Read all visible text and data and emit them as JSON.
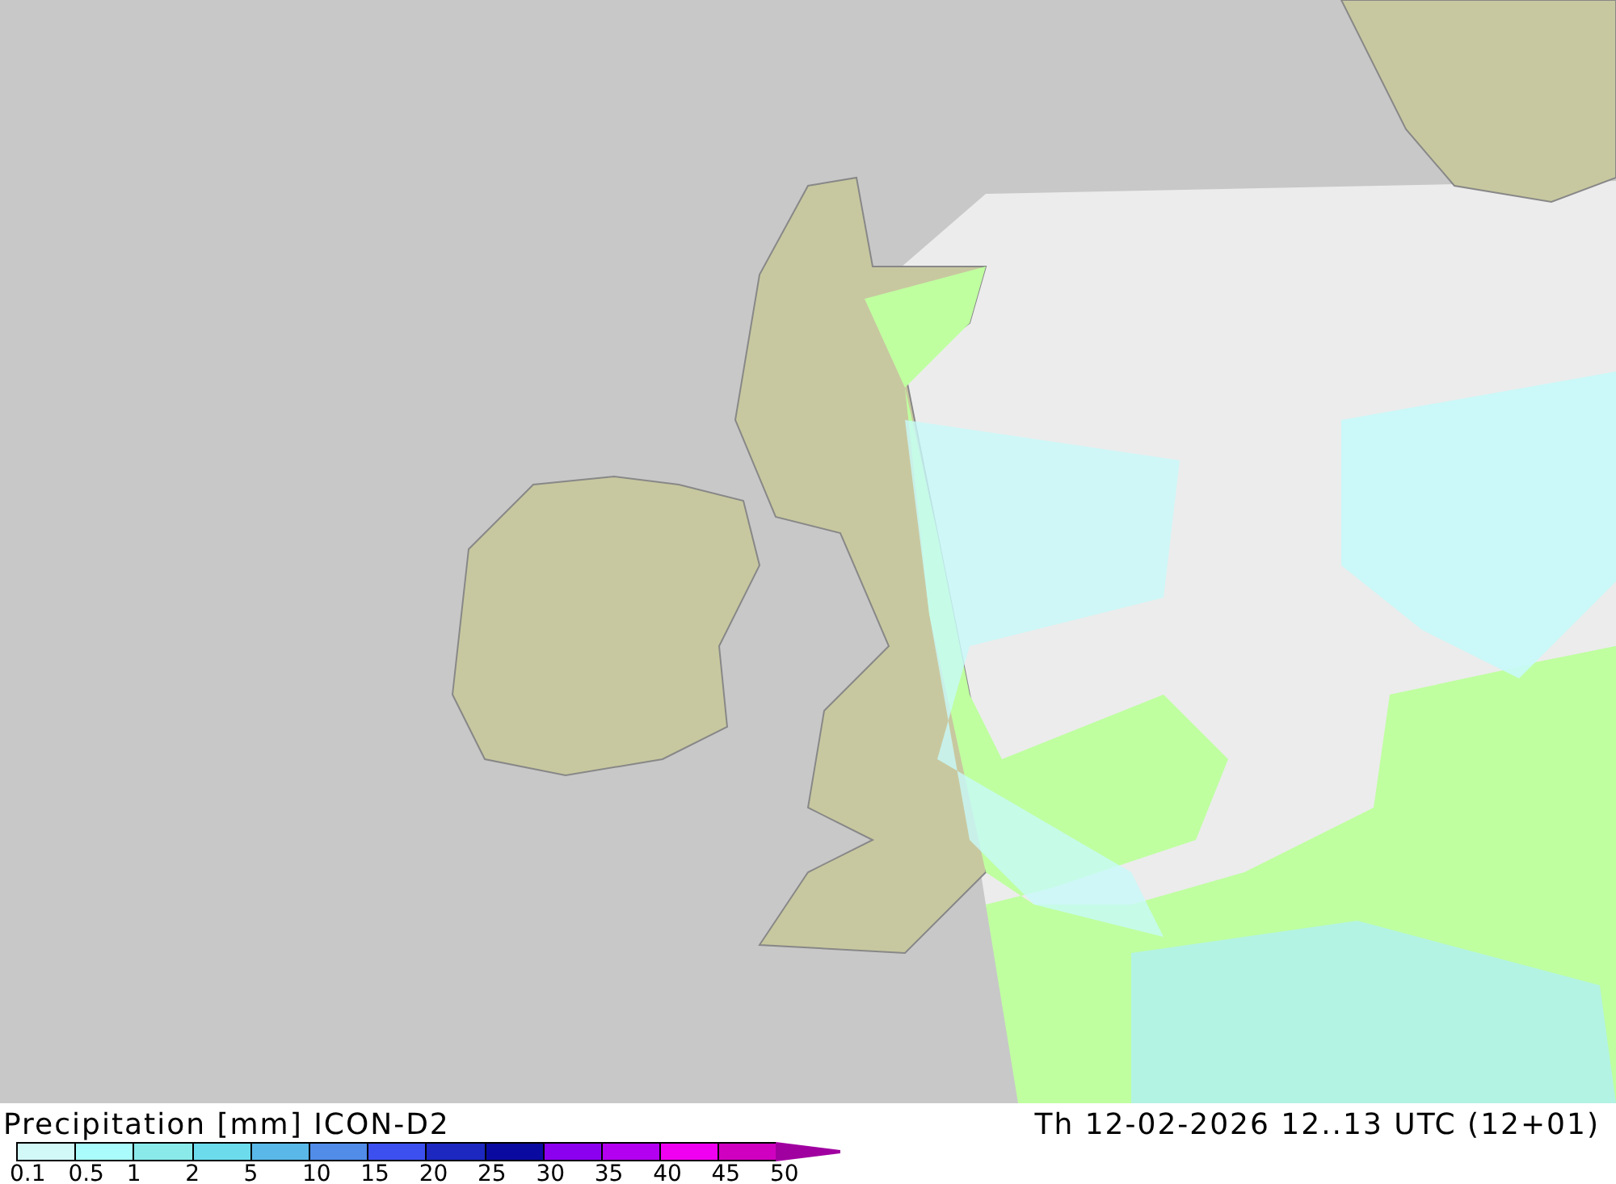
{
  "map": {
    "title": "Precipitation [mm] ICON-D2",
    "valid_time": "Th 12-02-2026 12..13 UTC (12+01)"
  },
  "legend": [
    {
      "kind": "swatch",
      "label": "0.1",
      "color": "#d2f8f8"
    },
    {
      "kind": "swatch",
      "label": "0.5",
      "color": "#aafcfc"
    },
    {
      "kind": "swatch",
      "label": "1",
      "color": "#8aeaea"
    },
    {
      "kind": "swatch",
      "label": "2",
      "color": "#6cdcec"
    },
    {
      "kind": "swatch",
      "label": "5",
      "color": "#5ab8e8"
    },
    {
      "kind": "swatch",
      "label": "10",
      "color": "#508ce8"
    },
    {
      "kind": "swatch",
      "label": "15",
      "color": "#3c50f0"
    },
    {
      "kind": "swatch",
      "label": "20",
      "color": "#1c28c0"
    },
    {
      "kind": "swatch",
      "label": "25",
      "color": "#0a0aa0"
    },
    {
      "kind": "swatch",
      "label": "30",
      "color": "#8c00f0"
    },
    {
      "kind": "swatch",
      "label": "35",
      "color": "#b400f0"
    },
    {
      "kind": "swatch",
      "label": "40",
      "color": "#f000f0"
    },
    {
      "kind": "swatch",
      "label": "45",
      "color": "#d000c0"
    },
    {
      "kind": "arrow",
      "label": "50",
      "color": "#a000a0"
    }
  ]
}
